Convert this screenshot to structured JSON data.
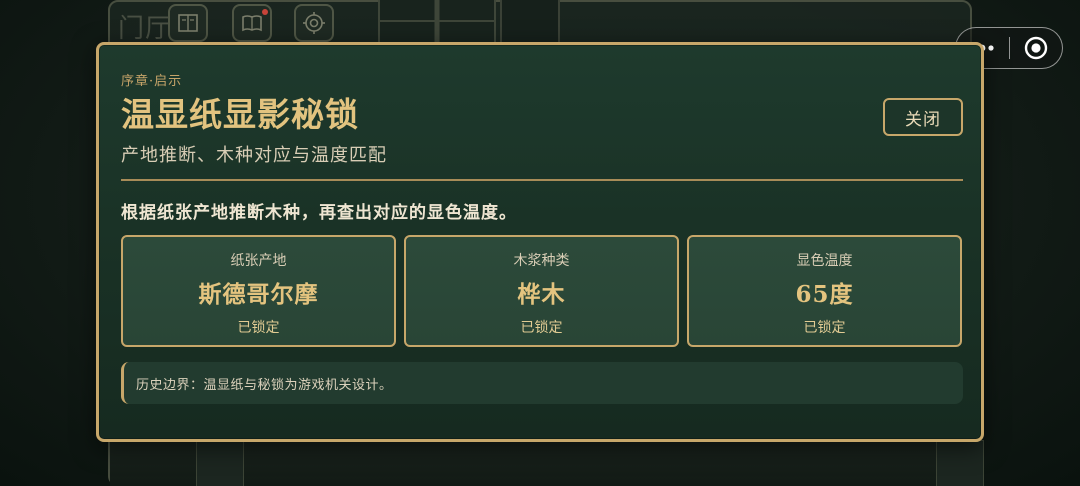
{
  "background": {
    "hall_title": "门厅",
    "buttons": [
      {
        "icon": "book-icon"
      },
      {
        "icon": "journal-icon",
        "has_notification": true
      },
      {
        "icon": "settings-icon"
      }
    ]
  },
  "capsule": {
    "more_icon": "more-dots-icon",
    "close_icon": "record-circle-icon"
  },
  "modal": {
    "chapter": "序章·启示",
    "title": "温显纸显影秘锁",
    "subtitle": "产地推断、木种对应与温度匹配",
    "close_label": "关闭",
    "instruction": "根据纸张产地推断木种，再查出对应的显色温度。",
    "cards": [
      {
        "label": "纸张产地",
        "value": "斯德哥尔摩",
        "status": "已锁定"
      },
      {
        "label": "木浆种类",
        "value": "桦木",
        "status": "已锁定"
      },
      {
        "label": "显色温度",
        "value": "65度",
        "status": "已锁定"
      }
    ],
    "note": "历史边界：温显纸与秘锁为游戏机关设计。"
  },
  "colors": {
    "accent_gold": "#c7a76a",
    "title_gold": "#e2c37f",
    "panel_green": "#1e3a2d",
    "card_green": "#2c4a3a"
  }
}
